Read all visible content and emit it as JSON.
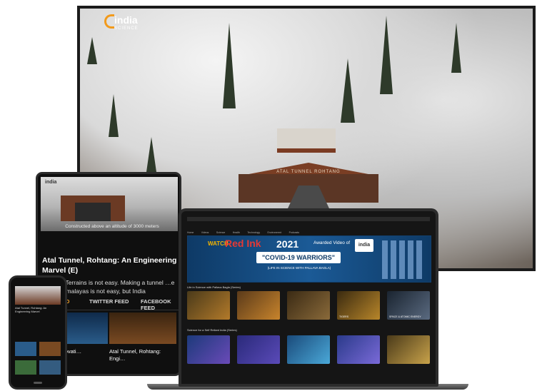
{
  "tv": {
    "logo_text": "india",
    "logo_sub": "SCIENCE",
    "tunnel_sign": "ATAL TUNNEL ROHTANG"
  },
  "tablet": {
    "logo_text": "india",
    "caption": "Constructed above an altitude of 3000 meters",
    "title": "Atal Tunnel, Rohtang: An Engineering Marvel (E)",
    "body": "…rough Terrains is not easy. Making a tunnel …e fragile Himalayas is not easy, but India",
    "tabs": [
      "ED",
      "TWITTER FEED",
      "FACEBOOK FEED"
    ],
    "cards": [
      {
        "title": "…rt-Up …ovati…"
      },
      {
        "title": "Atal Tunnel, Rohtang: Engi…"
      }
    ]
  },
  "phone": {
    "headline": "Atal Tunnel, Rohtang: An Engineering Marvel"
  },
  "laptop": {
    "nav": [
      "Home",
      "Videos",
      "Science",
      "Health",
      "Technology",
      "Environment",
      "Podcasts"
    ],
    "banner": {
      "watch": "WATCH",
      "red_ink": "Red Ink",
      "year": "2021",
      "awarded": "Awarded Video of",
      "logo": "india",
      "covid": "\"COVID-19 WARRIORS\"",
      "sub": "(LIFE IN SCIENCE WITH PALLAVA BAGLA)"
    },
    "section1": "Life in Science with Pallava Bagla (Series)",
    "row1": [
      "",
      "",
      "",
      "TIGERS",
      "SPACE & ATOMIC ENERGY"
    ],
    "section2": "Science for a Self Reliant India (Series)",
    "row2": [
      "",
      "",
      "",
      "",
      ""
    ]
  }
}
